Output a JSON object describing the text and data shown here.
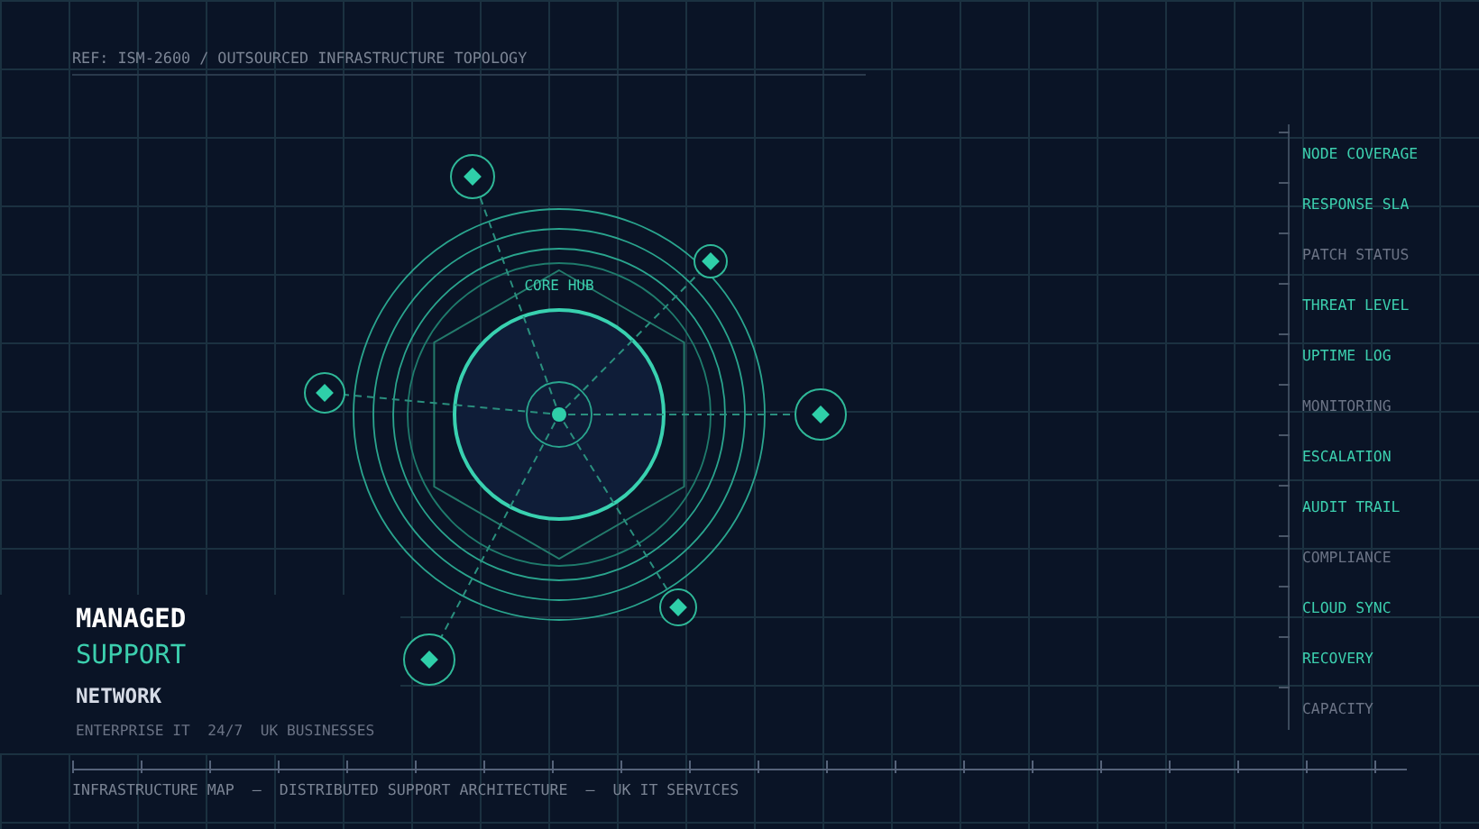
{
  "header": {
    "reference": "REF: ISM-2600 / OUTSOURCED INFRASTRUCTURE TOPOLOGY"
  },
  "topology": {
    "hub_label": "CORE HUB"
  },
  "metrics": [
    {
      "label": "NODE COVERAGE",
      "active": true
    },
    {
      "label": "RESPONSE SLA",
      "active": true
    },
    {
      "label": "PATCH STATUS",
      "active": false
    },
    {
      "label": "THREAT LEVEL",
      "active": true
    },
    {
      "label": "UPTIME LOG",
      "active": true
    },
    {
      "label": "MONITORING",
      "active": false
    },
    {
      "label": "ESCALATION",
      "active": true
    },
    {
      "label": "AUDIT TRAIL",
      "active": true
    },
    {
      "label": "COMPLIANCE",
      "active": false
    },
    {
      "label": "CLOUD SYNC",
      "active": true
    },
    {
      "label": "RECOVERY",
      "active": true
    },
    {
      "label": "CAPACITY",
      "active": false
    }
  ],
  "brand": {
    "line_1": "MANAGED",
    "line_2": "SUPPORT",
    "line_3": "NETWORK",
    "tagline": "ENTERPRISE IT  24/7  UK BUSINESSES"
  },
  "footer": {
    "caption": "INFRASTRUCTURE MAP  —  DISTRIBUTED SUPPORT ARCHITECTURE  —  UK IT SERVICES"
  }
}
